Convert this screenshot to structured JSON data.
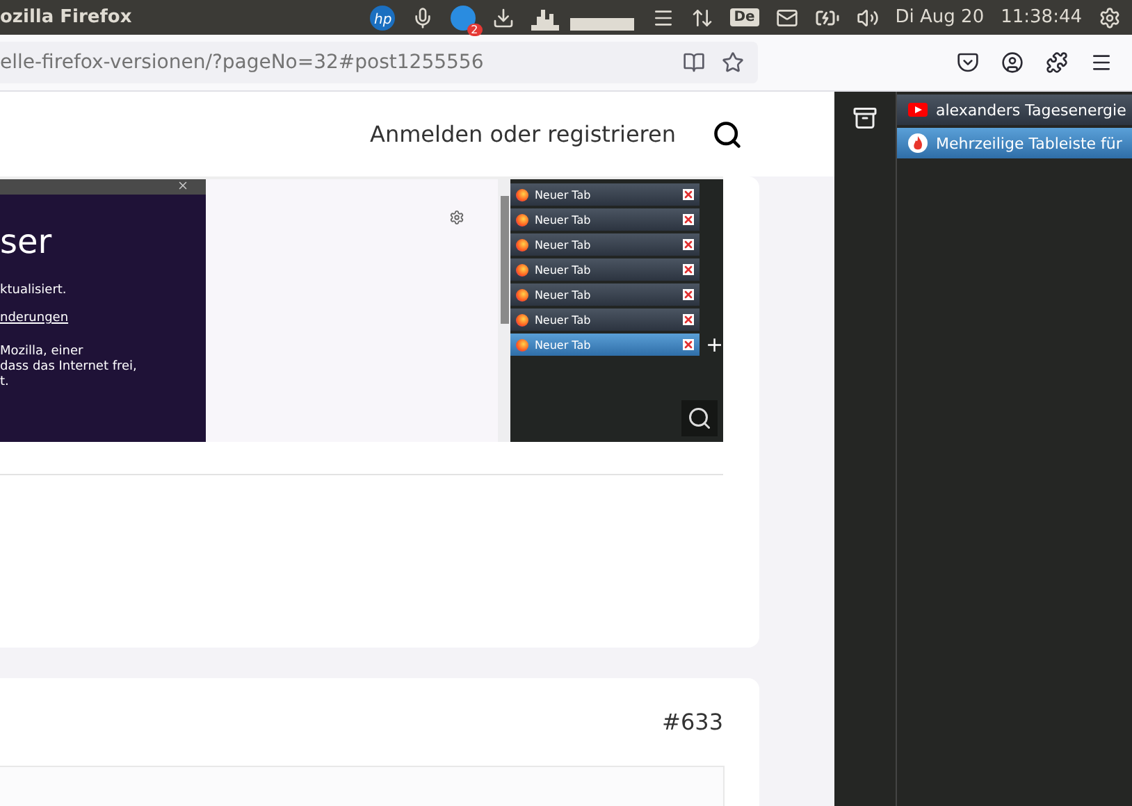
{
  "topbar": {
    "app_title": "ozilla Firefox",
    "printer_logo": "hp",
    "badge": "2",
    "keyboard": "De",
    "date": "Di Aug 20",
    "time": "11:38:44"
  },
  "address_bar": {
    "url": "elle-firefox-versionen/?pageNo=32#post1255556"
  },
  "site_header": {
    "login": "Anmelden oder registrieren"
  },
  "post": {
    "screenshot": {
      "heading": "ser",
      "lines": [
        {
          "kind": "text",
          "text": "ktualisiert."
        },
        {
          "kind": "link",
          "text": "nderungen"
        },
        {
          "kind": "rich",
          "text": "Mozilla, einer"
        },
        {
          "kind": "text",
          "text": "dass das Internet frei,"
        },
        {
          "kind": "text",
          "text": "t."
        }
      ],
      "tabs": [
        {
          "label": "Neuer Tab",
          "selected": false
        },
        {
          "label": "Neuer Tab",
          "selected": false
        },
        {
          "label": "Neuer Tab",
          "selected": false
        },
        {
          "label": "Neuer Tab",
          "selected": false
        },
        {
          "label": "Neuer Tab",
          "selected": false
        },
        {
          "label": "Neuer Tab",
          "selected": false
        },
        {
          "label": "Neuer Tab",
          "selected": true
        }
      ],
      "new_tab": "+"
    }
  },
  "next_post": {
    "number": "#633"
  },
  "sidebar": {
    "tabs": [
      {
        "label": "alexanders Tagesenergie",
        "kind": "video",
        "selected": false
      },
      {
        "label": "Mehrzeilige Tableiste für",
        "kind": "fire",
        "selected": true
      }
    ]
  }
}
